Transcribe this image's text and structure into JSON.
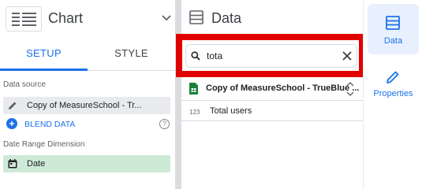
{
  "chart_panel": {
    "title": "Chart",
    "tabs": [
      {
        "label": "SETUP",
        "active": true
      },
      {
        "label": "STYLE",
        "active": false
      }
    ],
    "data_source_label": "Data source",
    "data_source_value": "Copy of MeasureSchool - Tr...",
    "blend_label": "BLEND DATA",
    "date_range_label": "Date Range Dimension",
    "date_range_value": "Date"
  },
  "data_panel": {
    "title": "Data",
    "search": {
      "value": "tota",
      "placeholder": ""
    },
    "source_name": "Copy of MeasureSchool - TrueBlue ...",
    "fields": [
      {
        "type_label": "123",
        "name": "Total users"
      }
    ]
  },
  "rail": {
    "items": [
      {
        "label": "Data",
        "active": true
      },
      {
        "label": "Properties",
        "active": false
      }
    ]
  },
  "colors": {
    "accent": "#1a73e8",
    "highlight_frame": "#e00000",
    "date_dimension_bg": "#ceead6",
    "sheets_green": "#188038"
  }
}
